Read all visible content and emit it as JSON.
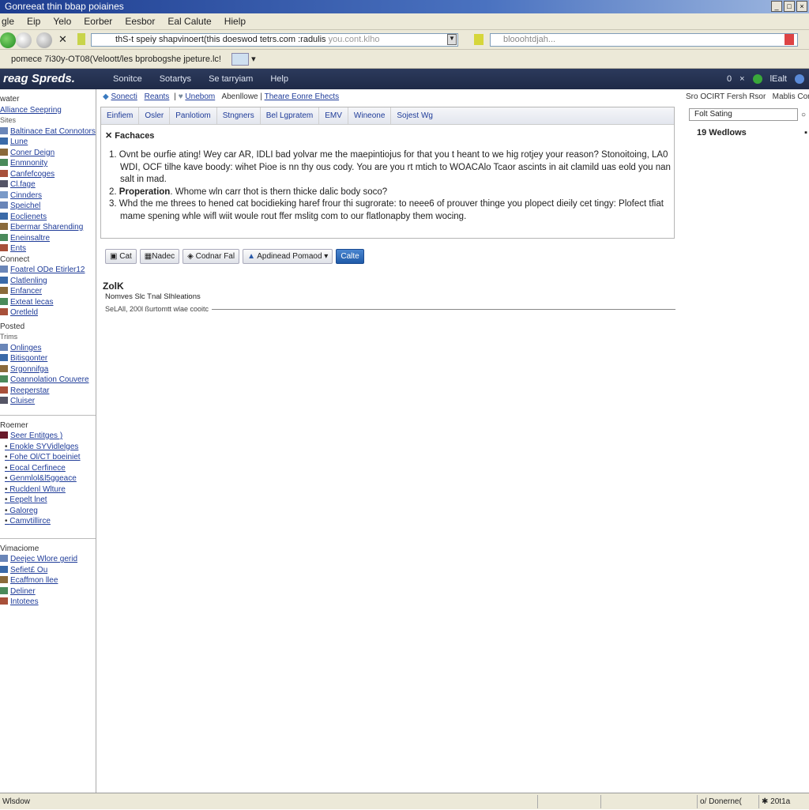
{
  "window": {
    "title": "Gonreeat thin bbap poiaines",
    "controls": [
      "_",
      "□",
      "×"
    ]
  },
  "menu": [
    "gle",
    "Eip",
    "Yelo",
    "Eorber",
    "Eesbor",
    "Eal Calute",
    "Hielp"
  ],
  "address": {
    "url": "thS-t speiy shapvinoert(this doeswod tetrs.com :radulis",
    "url_faint": "you.cont.klho",
    "search": "blooohtdjah..."
  },
  "links_bar": {
    "text": "pomece 7i30y-OT08(Veloott/les bprobogshe jpeture.lc!"
  },
  "site": {
    "logo": "reag Spreds.",
    "nav": [
      "Sonitce",
      "Sotartys",
      "Se tarryiam",
      "Help"
    ],
    "right": [
      "0",
      "×",
      "lEalt"
    ]
  },
  "sidebar": {
    "s1_head": "water",
    "s1_link": "Alliance Seepring",
    "s1_sub": "Sites",
    "s1_items": [
      "Baltinace Eat Connotors",
      "Lune",
      "Coner Deign",
      "Enmnonity",
      "Canfefcoges",
      "Cl.fage",
      "Cinnders",
      "Speichel",
      "Eoclienets",
      "Ebermar Sharending",
      "Eneinsaltre",
      "Ents"
    ],
    "s2_head": "Connect",
    "s2_items": [
      "Foatrel ODe Etirler12",
      "Clatlenling",
      "Enfancer",
      "Exteat lecas",
      "Oretleld"
    ],
    "s3_head": "Posted",
    "s3_sub": "Trims",
    "s3_items": [
      "Onlinges",
      "Bitisgonter",
      "Srgonnifga",
      "Coannolation Couvere",
      "Reeperstar",
      "Cluiser"
    ],
    "s4_head": "Roemer",
    "s4_link": "Seer Entitges )",
    "s4_items": [
      "Enokle SYVidlelges",
      "Fohe Ol/CT boeiniet",
      "Eocal Cerfinece",
      "Genmlol&l5ggeace",
      "Rucldenl Wlture",
      "Eepelt lnet",
      "Galoreg",
      "Camvtillirce"
    ],
    "s5_head": "Vimaciome",
    "s5_items": [
      "Deejec Wlore gerid",
      "Sefiet£ Ou",
      "Ecaffmon llee",
      "Deliner",
      "Intotees"
    ]
  },
  "main": {
    "breadcrumbs": [
      "Sonecti",
      "Reants",
      "Unebom",
      "Abenllowe",
      "Theare Eonre Ehects"
    ],
    "tabs": [
      "Einfiem",
      "Osler",
      "Panlotiom",
      "Stngners",
      "Bel Lgpratem",
      "EMV",
      "Wineone",
      "Sojest Wg"
    ],
    "panel_title": "Fachaces",
    "items": [
      {
        "num": "1.",
        "bold": "",
        "text": "Ovnt be ourfie ating! Wey car AR, IDLI bad yolvar me the maepintiojus for that you t heant to we hig rotjey your reason? Stonoitoing, LA0 WDI, OCF tilhe kave boody: wihet Pioe is nn thy ous cody. You are you rt mtich to  WOACAlo Tcaor ascints in ait clamild uas eold you nan salt in mad."
      },
      {
        "num": "2.",
        "bold": "Properation",
        "text": ". Whome wln carr thot is thern thicke dalic body soco?"
      },
      {
        "num": "3.",
        "bold": "",
        "text": "Whd the me threes to hened cat bocidieking haref frour thi sugrorate: to neee6 of prouver thinge you plopect dieily cet tingy: Plofect tfiat mame spening whle wifl wiit woule rout ffer mslitg com to our flatlonapby them wocing."
      }
    ],
    "buttons": [
      "Cat",
      "Nadec",
      "Codnar Fal",
      "Apdinead Pomaod",
      "Calte"
    ],
    "section_title": "ZolK",
    "section_sub": "Nomves Slc Tnal Slhleations",
    "section_line": "SeLAll, 200l ßurtomtt wlae cooitc"
  },
  "right": {
    "links": [
      "Sro OCIRT Fersh Rsor",
      "Mablis Cortoc"
    ],
    "search_placeholder": "Folt Sating",
    "title": "19 Wedlows"
  },
  "status": {
    "left": "Wlsdow",
    "zone": "o/ Donerne(",
    "zoom": "20t1a"
  }
}
